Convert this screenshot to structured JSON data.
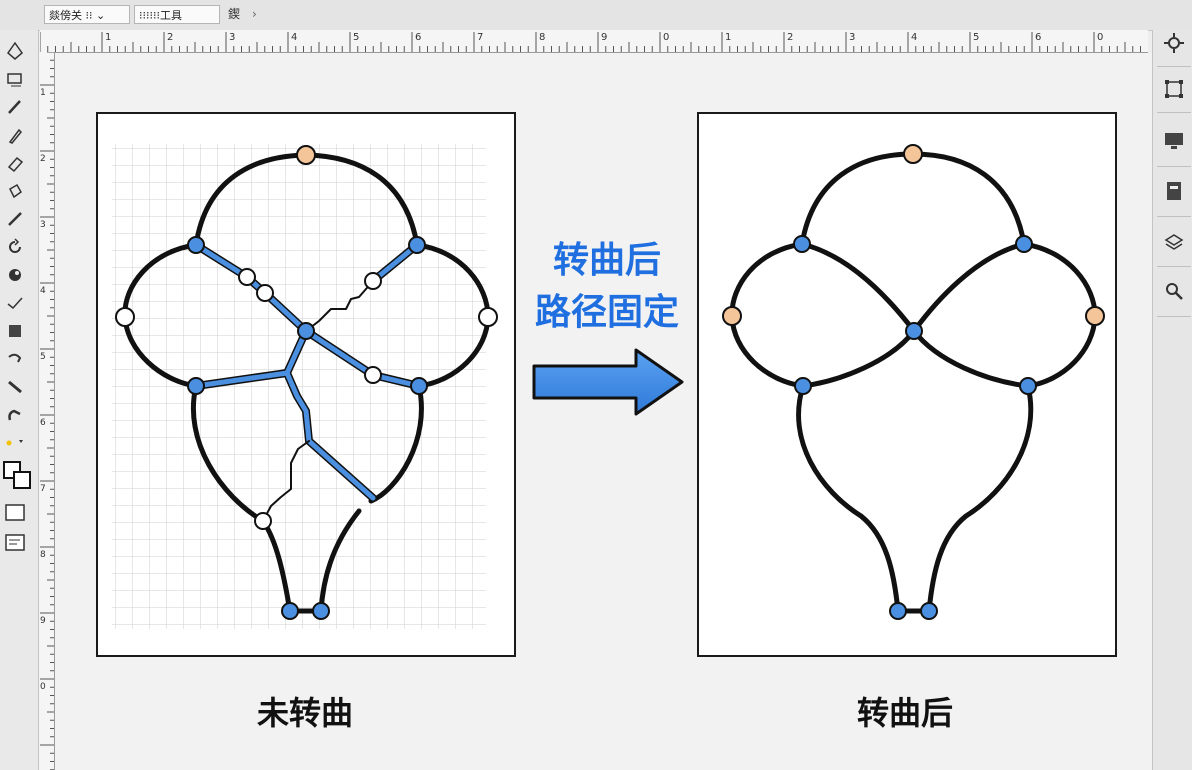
{
  "topbar": {
    "field1": "燚傍关 ⁝⁝ ⌄",
    "field2": "⁝⁝⁝⁝⁝⁝工具",
    "extra_label": "鍥",
    "extra_arrow": "›"
  },
  "ruler": {
    "h_labels": [
      "1",
      "2",
      "3",
      "4",
      "5",
      "6",
      "7",
      "8",
      "9",
      "0",
      "1",
      "2",
      "3",
      "4",
      "5",
      "6",
      "0"
    ],
    "v_labels": [
      "1",
      "2",
      "3",
      "4",
      "5",
      "6",
      "7",
      "8",
      "9",
      "0"
    ]
  },
  "tools": {
    "left": [
      "pen-tool-icon",
      "rectangle-tool-icon",
      "pencil-icon",
      "brush-icon",
      "eraser-icon",
      "paint-bucket-icon",
      "line-icon",
      "rotate-icon",
      "blob-icon",
      "check-icon",
      "square-icon",
      "smudge-icon",
      "knife-icon",
      "hand-icon",
      "fill-stroke-swatch",
      "screen-mode-icon",
      "note-icon"
    ],
    "right": [
      "gear-icon",
      "transform-icon",
      "monitor-icon",
      "document-icon",
      "layers-icon",
      "search-icon"
    ]
  },
  "canvas": {
    "left_caption": "未转曲",
    "right_caption": "转曲后",
    "middle_line1": "转曲后",
    "middle_line2": "路径固定"
  },
  "colors": {
    "accent_blue": "#4a8fe0",
    "middle_text_blue": "#1f6fe0",
    "anchor_orange": "#f5c59a",
    "anchor_white": "#ffffff",
    "outline": "#111111"
  }
}
